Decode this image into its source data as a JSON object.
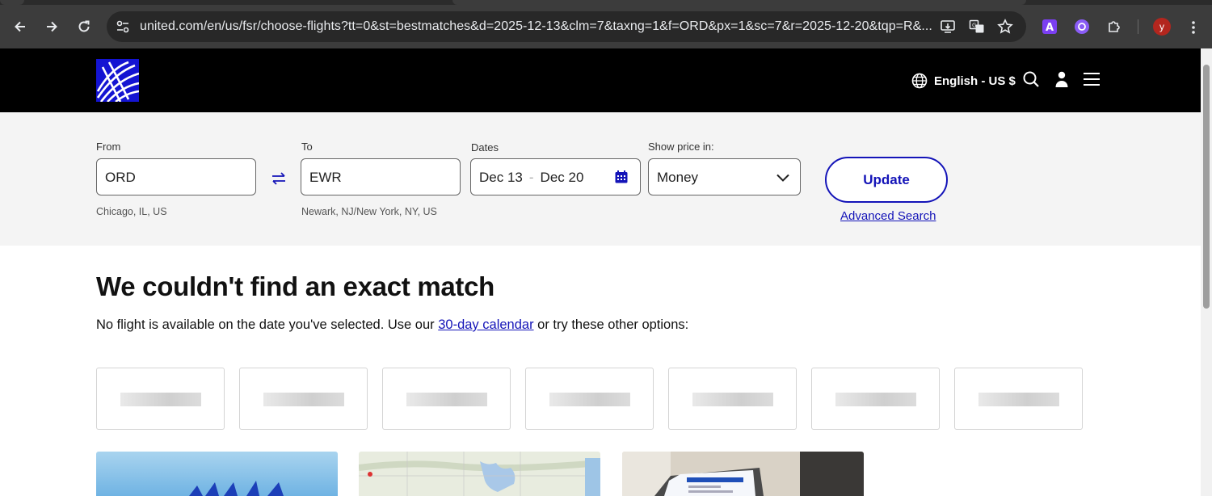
{
  "browser": {
    "url": "united.com/en/us/fsr/choose-flights?tt=0&st=bestmatches&d=2025-12-13&clm=7&taxng=1&f=ORD&px=1&sc=7&r=2025-12-20&tqp=R&...",
    "profile_initial": "y"
  },
  "header": {
    "language": "English - US $"
  },
  "search": {
    "from": {
      "label": "From",
      "value": "ORD",
      "city": "Chicago, IL, US"
    },
    "to": {
      "label": "To",
      "value": "EWR",
      "city": "Newark, NJ/New York, NY, US"
    },
    "dates": {
      "label": "Dates",
      "depart": "Dec 13",
      "separator": "-",
      "return": "Dec 20"
    },
    "price": {
      "label": "Show price in:",
      "value": "Money"
    },
    "update_label": "Update",
    "advanced_label": "Advanced Search"
  },
  "main": {
    "headline": "We couldn't find an exact match",
    "message_before": "No flight is available on the date you've selected. Use our ",
    "calendar_link": "30-day calendar",
    "message_after": " or try these other options:"
  },
  "colors": {
    "brand_blue": "#1414b8",
    "header_bg": "#000000",
    "panel_bg": "#f4f4f4"
  }
}
